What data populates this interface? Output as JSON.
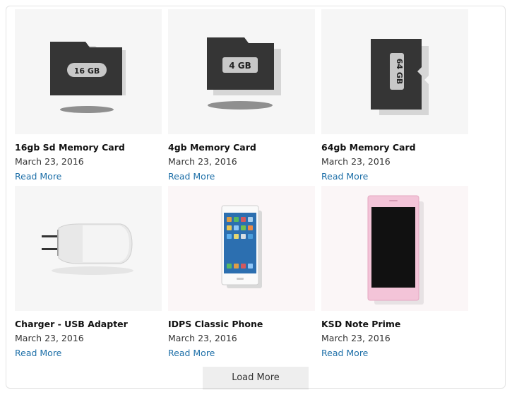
{
  "products": [
    {
      "title": "16gb Sd Memory Card",
      "date": "March 23, 2016",
      "link": "Read More",
      "icon": "sd-card-16gb",
      "card_label": "16 GB"
    },
    {
      "title": "4gb Memory Card",
      "date": "March 23, 2016",
      "link": "Read More",
      "icon": "sd-card-4gb",
      "card_label": "4 GB"
    },
    {
      "title": "64gb Memory Card",
      "date": "March 23, 2016",
      "link": "Read More",
      "icon": "sd-card-64gb",
      "card_label": "64 GB"
    },
    {
      "title": "Charger - USB Adapter",
      "date": "March 23, 2016",
      "link": "Read More",
      "icon": "charger"
    },
    {
      "title": "IDPS Classic Phone",
      "date": "March 23, 2016",
      "link": "Read More",
      "icon": "phone-white"
    },
    {
      "title": "KSD Note Prime",
      "date": "March 23, 2016",
      "link": "Read More",
      "icon": "phone-pink"
    }
  ],
  "load_more_label": "Load More",
  "colors": {
    "link": "#1d6fa8",
    "title": "#111111",
    "card_body": "#3a3a3a",
    "phone_pink": "#f3c4d8"
  }
}
